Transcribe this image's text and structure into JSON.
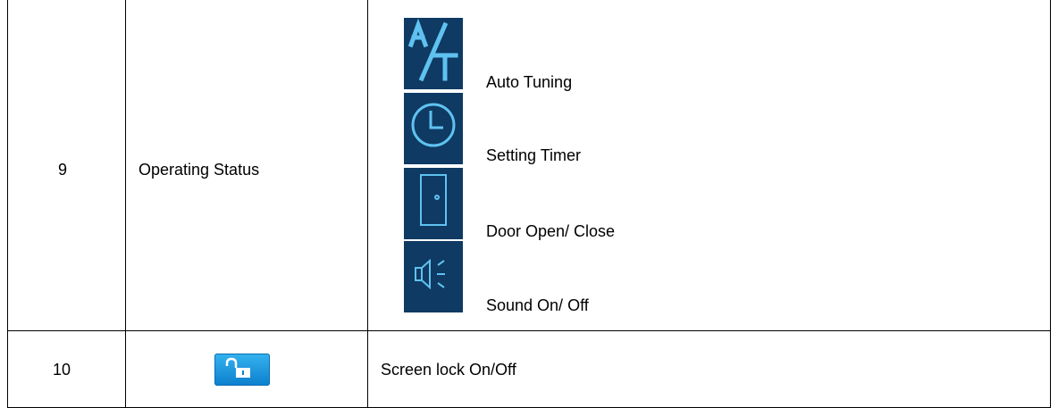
{
  "rows": [
    {
      "number": "9",
      "feature": "Operating Status",
      "icons": [
        {
          "icon": "auto-tuning-icon",
          "label": "Auto Tuning"
        },
        {
          "icon": "clock-icon",
          "label": "Setting Timer"
        },
        {
          "icon": "door-icon",
          "label": "Door Open/ Close"
        },
        {
          "icon": "speaker-icon",
          "label": "Sound On/ Off"
        }
      ]
    },
    {
      "number": "10",
      "icon": "unlock-icon",
      "description": "Screen lock On/Off"
    }
  ],
  "colors": {
    "icon_background": "#0e3a63",
    "icon_foreground": "#5fc2f0",
    "lock_button": "#1f9ae0"
  }
}
